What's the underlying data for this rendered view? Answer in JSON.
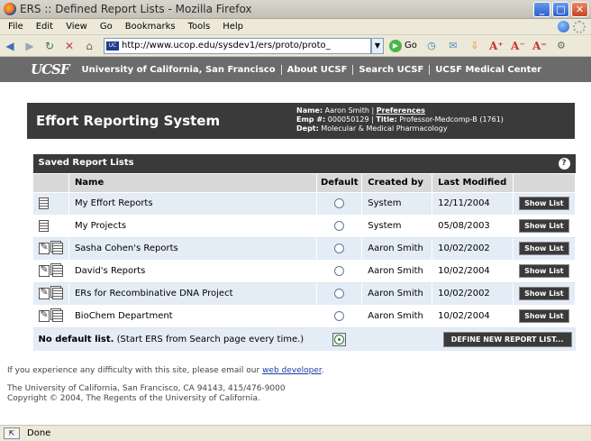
{
  "window": {
    "title": "ERS :: Defined Report Lists - Mozilla Firefox",
    "minimize": "_",
    "maximize": "□",
    "close": "✕"
  },
  "menu": {
    "items": [
      "File",
      "Edit",
      "View",
      "Go",
      "Bookmarks",
      "Tools",
      "Help"
    ]
  },
  "toolbar": {
    "url": "http://www.ucop.edu/sysdev1/ers/proto/proto_",
    "favicon_text": "UC",
    "go_label": "Go"
  },
  "ucsf_bar": {
    "logo": "UCSF",
    "links": [
      "University of California, San Francisco",
      "About UCSF",
      "Search UCSF",
      "UCSF Medical Center"
    ]
  },
  "header": {
    "title": "Effort Reporting System",
    "name_label": "Name:",
    "name_value": "Aaron Smith",
    "preferences": "Preferences",
    "emp_label": "Emp #:",
    "emp_value": "000050129",
    "title_label": "Title:",
    "title_value": "Professor-Medcomp-B (1761)",
    "dept_label": "Dept:",
    "dept_value": "Molecular & Medical Pharmacology"
  },
  "reports": {
    "section_title": "Saved Report Lists",
    "help": "?",
    "columns": [
      "Name",
      "Default",
      "Created by",
      "Last Modified"
    ],
    "rows": [
      {
        "name": "My Effort Reports",
        "created_by": "System",
        "modified": "12/11/2004",
        "editable": false
      },
      {
        "name": "My Projects",
        "created_by": "System",
        "modified": "05/08/2003",
        "editable": false
      },
      {
        "name": "Sasha Cohen's Reports",
        "created_by": "Aaron Smith",
        "modified": "10/02/2002",
        "editable": true
      },
      {
        "name": "David's Reports",
        "created_by": "Aaron Smith",
        "modified": "10/02/2004",
        "editable": true
      },
      {
        "name": "ERs for Recombinative DNA Project",
        "created_by": "Aaron Smith",
        "modified": "10/02/2002",
        "editable": true
      },
      {
        "name": "BioChem Department",
        "created_by": "Aaron Smith",
        "modified": "10/02/2004",
        "editable": true
      }
    ],
    "show_list_label": "Show List",
    "no_default_bold": "No default list.",
    "no_default_rest": "(Start ERS from Search page every time.)",
    "define_new_label": "DEFINE NEW REPORT LIST..."
  },
  "footer": {
    "line1_pre": "If you experience any difficulty with this site, please email our",
    "line1_link": "web developer",
    "line1_post": ".",
    "line2": "The University of California, San Francisco, CA 94143, 415/476-9000",
    "line3": "Copyright © 2004, The Regents of the University of California."
  },
  "status": {
    "text": "Done"
  }
}
